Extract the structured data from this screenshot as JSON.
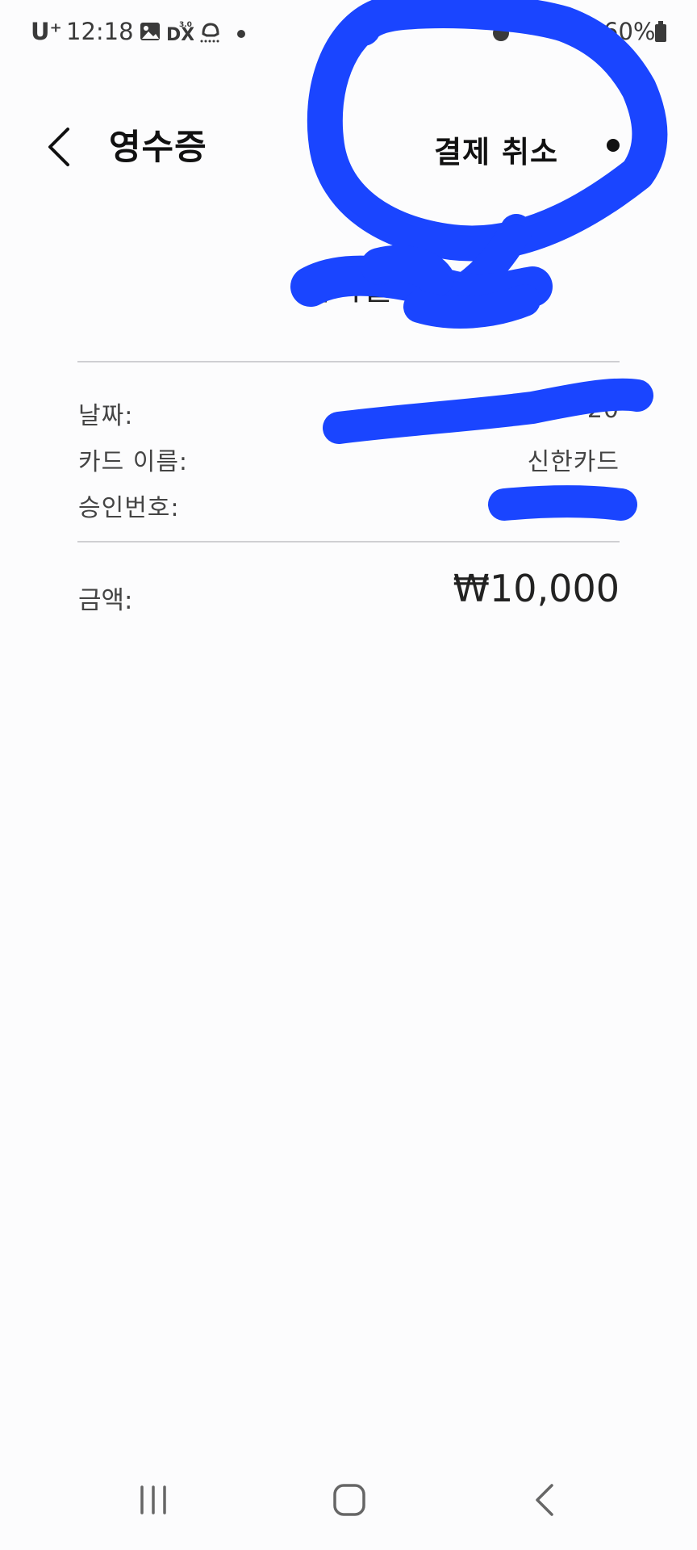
{
  "status_bar": {
    "carrier": "U⁺",
    "time": "12:18",
    "battery": "60%",
    "icons": [
      "gallery-icon",
      "dlx-icon",
      "voice-record-icon",
      "notification-dot-icon",
      "alarm-icon",
      "battery-icon"
    ]
  },
  "header": {
    "title": "영수증",
    "cancel_label": "결제 취소",
    "back_icon": "chevron-left-icon",
    "more_icon": "more-options-icon"
  },
  "receipt": {
    "merchant": "가마솥",
    "rows": [
      {
        "label": "날짜:",
        "value": "20"
      },
      {
        "label": "카드 이름:",
        "value": "신한카드"
      },
      {
        "label": "승인번호:",
        "value": "2"
      }
    ],
    "amount_label": "금액:",
    "amount_value": "₩10,000"
  },
  "navigation_bar": {
    "icons": [
      "recent-apps-icon",
      "home-icon",
      "back-icon"
    ]
  },
  "colors": {
    "background": "#fcfcfd",
    "marker": "#1a45ff",
    "divider": "#cfcfd2",
    "text": "#111111"
  }
}
